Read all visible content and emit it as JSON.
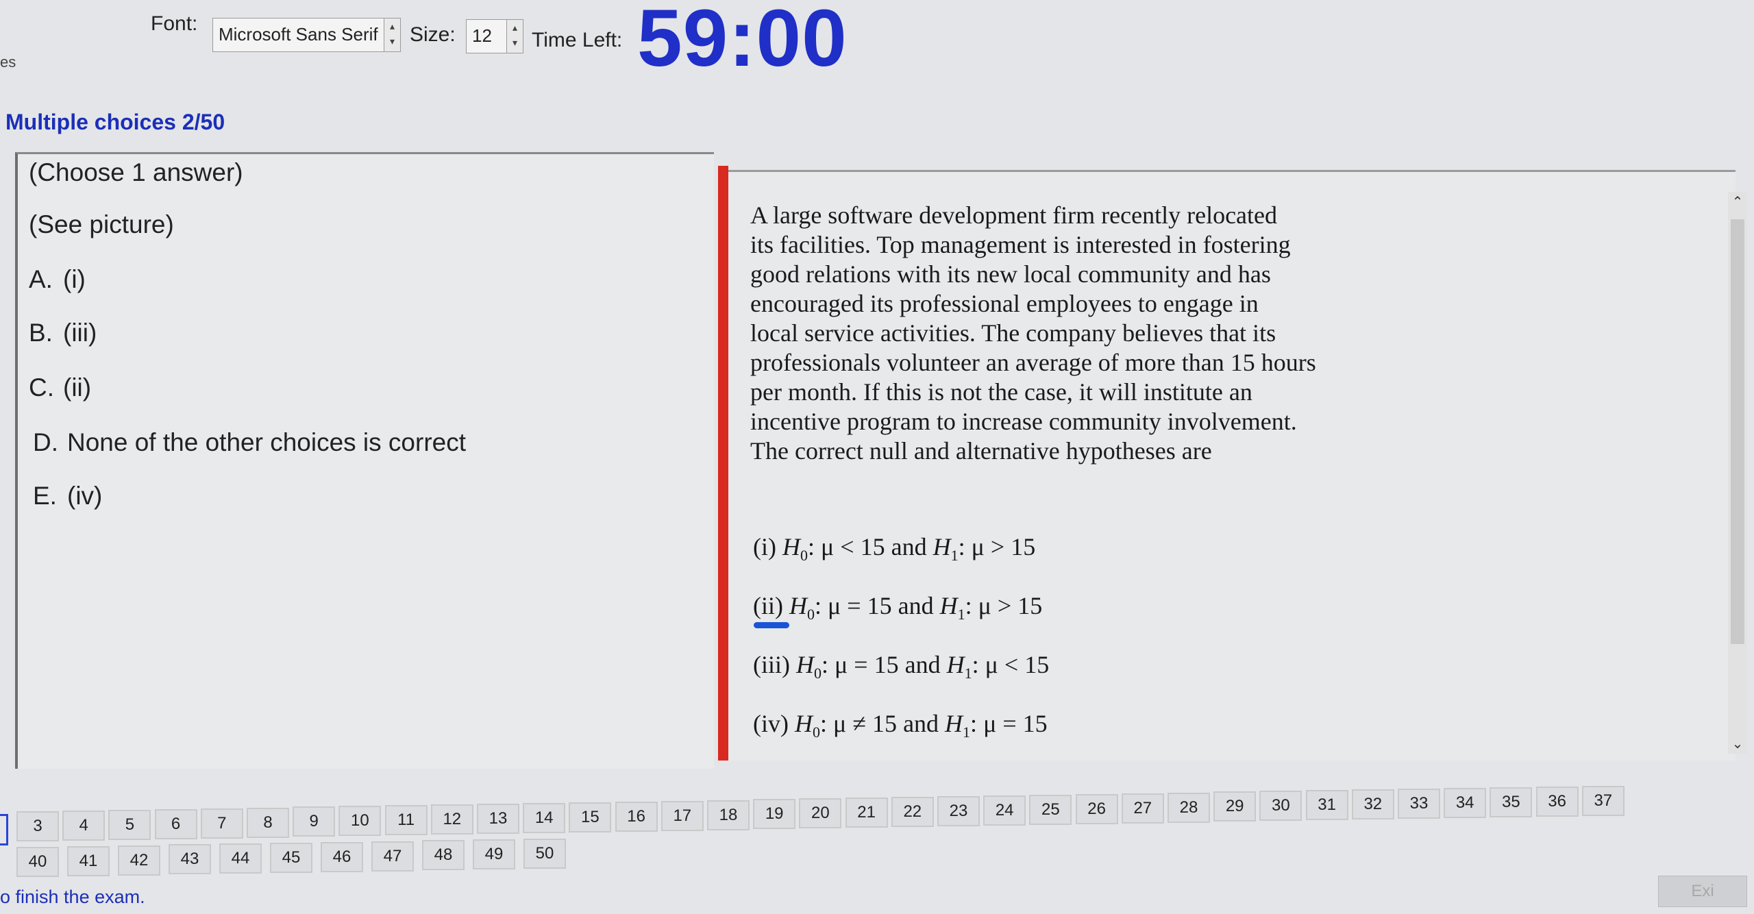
{
  "toolbar": {
    "font_label": "Font:",
    "font_value": "Microsoft Sans Serif",
    "size_label": "Size:",
    "size_value": "12",
    "time_label": "Time Left:",
    "time_value": "59:00",
    "cut_left_text": "es"
  },
  "section_title": "Multiple choices 2/50",
  "left": {
    "instruction": "(Choose 1 answer)",
    "see_picture": "(See picture)",
    "choices": [
      {
        "letter": "A.",
        "text": "(i)"
      },
      {
        "letter": "B.",
        "text": "(iii)"
      },
      {
        "letter": "C.",
        "text": "(ii)"
      },
      {
        "letter": "D.",
        "text": "None of the other choices is correct"
      },
      {
        "letter": "E.",
        "text": "(iv)"
      }
    ]
  },
  "question": {
    "lines": [
      "A large software development firm recently relocated",
      "its facilities. Top management is interested in fostering",
      "good relations with its new local community and has",
      "encouraged its professional employees to engage in",
      "local service activities. The company believes that its",
      "professionals volunteer an average of more than 15 hours",
      "per month. If this is not the case, it will institute an",
      "incentive program to increase community involvement.",
      "The correct null and alternative hypotheses are"
    ],
    "hypotheses": [
      {
        "num": "(i)",
        "h0_rel": "μ < 15",
        "h1_rel": "μ > 15"
      },
      {
        "num": "(ii)",
        "h0_rel": "μ = 15",
        "h1_rel": "μ > 15"
      },
      {
        "num": "(iii)",
        "h0_rel": "μ = 15",
        "h1_rel": "μ < 15"
      },
      {
        "num": "(iv)",
        "h0_rel": "μ ≠ 15",
        "h1_rel": "μ = 15"
      }
    ],
    "and_word": "and",
    "h_letter": "H",
    "h0_sub": "0",
    "h1_sub": "1"
  },
  "nav": {
    "row1": [
      "3",
      "4",
      "5",
      "6",
      "7",
      "8",
      "9",
      "10",
      "11",
      "12",
      "13",
      "14",
      "15",
      "16",
      "17",
      "18",
      "19",
      "20",
      "21",
      "22",
      "23",
      "24",
      "25",
      "26",
      "27",
      "28",
      "29",
      "30",
      "31",
      "32",
      "33",
      "34",
      "35",
      "36",
      "37"
    ],
    "row2": [
      "40",
      "41",
      "42",
      "43",
      "44",
      "45",
      "46",
      "47",
      "48",
      "49",
      "50"
    ]
  },
  "footer": {
    "finish_text": "o finish the exam.",
    "exit_label": "Exi"
  },
  "colors": {
    "timer": "#1f2fc7",
    "title": "#1b2fb8",
    "divider": "#d82a20",
    "underline": "#1a54d6"
  }
}
